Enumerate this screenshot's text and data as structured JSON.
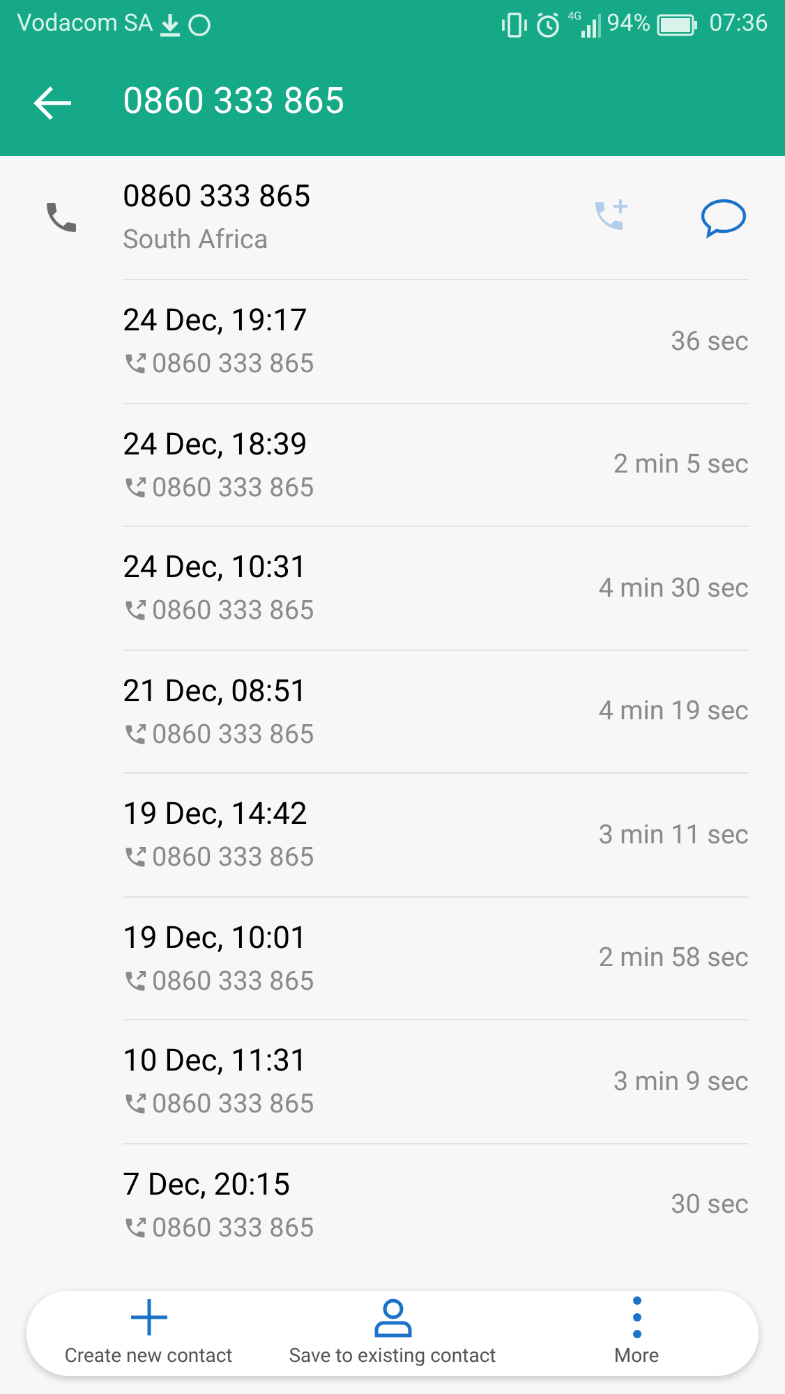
{
  "status_bar": {
    "carrier": "Vodacom SA",
    "network": "4G",
    "battery": "94%",
    "time": "07:36"
  },
  "app_bar": {
    "title": "0860 333 865"
  },
  "contact": {
    "number": "0860 333 865",
    "location": "South Africa",
    "add_call": {
      "disabled": true
    }
  },
  "calls": [
    {
      "date": "24 Dec, 19:17",
      "number": "0860 333 865",
      "duration": "36 sec"
    },
    {
      "date": "24 Dec, 18:39",
      "number": "0860 333 865",
      "duration": "2 min 5 sec"
    },
    {
      "date": "24 Dec, 10:31",
      "number": "0860 333 865",
      "duration": "4 min 30 sec"
    },
    {
      "date": "21 Dec, 08:51",
      "number": "0860 333 865",
      "duration": "4 min 19 sec"
    },
    {
      "date": "19 Dec, 14:42",
      "number": "0860 333 865",
      "duration": "3 min 11 sec"
    },
    {
      "date": "19 Dec, 10:01",
      "number": "0860 333 865",
      "duration": "2 min 58 sec"
    },
    {
      "date": "10 Dec, 11:31",
      "number": "0860 333 865",
      "duration": "3 min 9 sec"
    },
    {
      "date": "7 Dec, 20:15",
      "number": "0860 333 865",
      "duration": "30 sec"
    }
  ],
  "actions": [
    {
      "kind": "add",
      "label": "Create new contact"
    },
    {
      "kind": "person",
      "label": "Save to existing contact"
    },
    {
      "kind": "more",
      "label": "More"
    }
  ]
}
